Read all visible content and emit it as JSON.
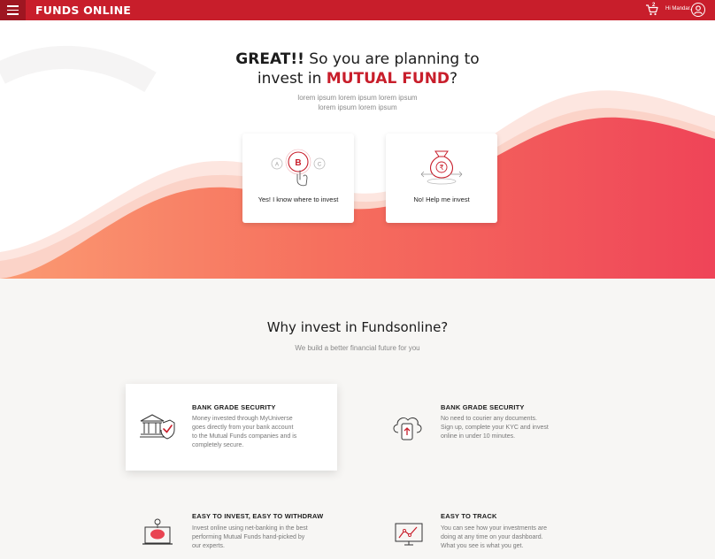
{
  "header": {
    "brand": "FUNDS ONLINE",
    "cart_count": "2",
    "greeting": "Hi Mandar,",
    "icons": [
      "menu-icon",
      "cart-icon",
      "user-avatar-icon"
    ]
  },
  "hero": {
    "title_bold": "GREAT!!",
    "title_line1_rest": " So you are planning to",
    "title_line2_prefix": "invest in ",
    "title_accent": "MUTUAL FUND",
    "title_line2_suffix": "?",
    "subtitle_line1": "lorem ipsum lorem ipsum lorem ipsum",
    "subtitle_line2": "lorem ipsum lorem ipsum",
    "choices": [
      {
        "label": "Yes! I know where to invest",
        "icon": "abc-choice-icon",
        "option_letters": [
          "A",
          "B",
          "C"
        ]
      },
      {
        "label": "No! Help me invest",
        "icon": "money-bag-icon"
      }
    ]
  },
  "why": {
    "title": "Why invest in Fundsonline?",
    "subtitle": "We build a better financial future for you",
    "features": [
      {
        "heading": "BANK GRADE SECURITY",
        "lines": [
          "Money invested through MyUniverse",
          "goes directly from your bank account",
          "to the Mutual Funds companies and is",
          "completely secure."
        ],
        "icon": "bank-shield-icon"
      },
      {
        "heading": "BANK GRADE SECURITY",
        "lines": [
          "No need to courier any documents.",
          "Sign up, complete your KYC and invest",
          "online in under 10 minutes."
        ],
        "icon": "cloud-phone-icon"
      },
      {
        "heading": "EASY TO INVEST, EASY TO WITHDRAW",
        "lines": [
          "Invest online using net-banking in the best",
          "performing  Mutual Funds hand-picked by",
          "our experts."
        ],
        "icon": "piggy-bank-laptop-icon"
      },
      {
        "heading": "EASY TO TRACK",
        "lines": [
          "You can see how your investments are",
          "doing at any time on your dashboard.",
          "What you see is what you get."
        ],
        "icon": "chart-monitor-icon"
      }
    ]
  },
  "colors": {
    "brand_red": "#c81e2b",
    "wave_orange": "#f7826a",
    "wave_red": "#ef4458"
  }
}
